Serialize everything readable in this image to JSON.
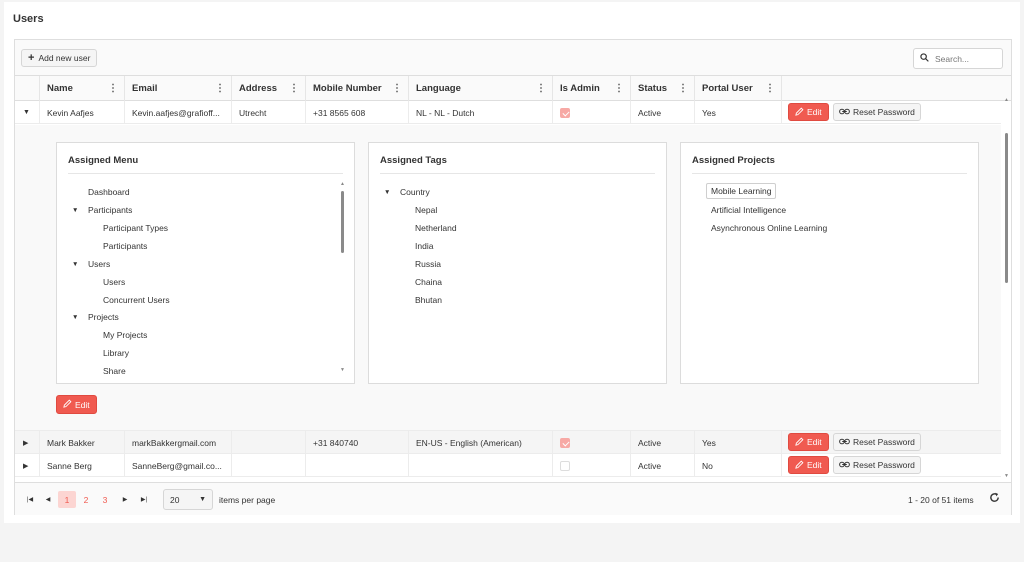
{
  "page": {
    "title": "Users"
  },
  "toolbar": {
    "add_label": "Add new user",
    "search_placeholder": "Search..."
  },
  "columns": [
    "Name",
    "Email",
    "Address",
    "Mobile Number",
    "Language",
    "Is Admin",
    "Status",
    "Portal User"
  ],
  "rows": [
    {
      "name": "Kevin Aafjes",
      "email": "Kevin.aafjes@grafioff...",
      "address": "Utrecht",
      "mobile": "+31 8565 608",
      "language": "NL - NL - Dutch",
      "is_admin": true,
      "status": "Active",
      "portal_user": "Yes",
      "expanded": true
    },
    {
      "name": "Mark Bakker",
      "email": "markBakkergmail.com",
      "address": "",
      "mobile": "+31 840740",
      "language": "EN-US - English (American)",
      "is_admin": true,
      "status": "Active",
      "portal_user": "Yes",
      "expanded": false
    },
    {
      "name": "Sanne Berg",
      "email": "SanneBerg@gmail.co...",
      "address": "",
      "mobile": "",
      "language": "",
      "is_admin": false,
      "status": "Active",
      "portal_user": "No",
      "expanded": false
    }
  ],
  "actions": {
    "edit": "Edit",
    "reset": "Reset Password"
  },
  "detail": {
    "menu_title": "Assigned Menu",
    "menu_items": [
      "Dashboard",
      "Participants",
      "Participant Types",
      "Participants",
      "Users",
      "Users",
      "Concurrent Users",
      "Projects",
      "My Projects",
      "Library",
      "Share"
    ],
    "tags_title": "Assigned Tags",
    "tags_root": "Country",
    "tags": [
      "Nepal",
      "Netherland",
      "India",
      "Russia",
      "Chaina",
      "Bhutan"
    ],
    "projects_title": "Assigned Projects",
    "projects": [
      "Mobile Learning",
      "Artificial Intelligence",
      "Asynchronous Online Learning"
    ],
    "edit_label": "Edit"
  },
  "pager": {
    "pages": [
      "1",
      "2",
      "3"
    ],
    "current_page": 1,
    "page_size": "20",
    "items_per_page": "items per page",
    "range": "1 - 20 of 51 items"
  },
  "colors": {
    "accent": "#f05a50",
    "checked": "#f7a9a5"
  },
  "icons": [
    "plus-icon",
    "search-icon",
    "more-vertical-icon",
    "pencil-icon",
    "link-icon",
    "caret-down-icon",
    "caret-right-icon",
    "first-page-icon",
    "prev-page-icon",
    "next-page-icon",
    "last-page-icon",
    "refresh-icon"
  ]
}
